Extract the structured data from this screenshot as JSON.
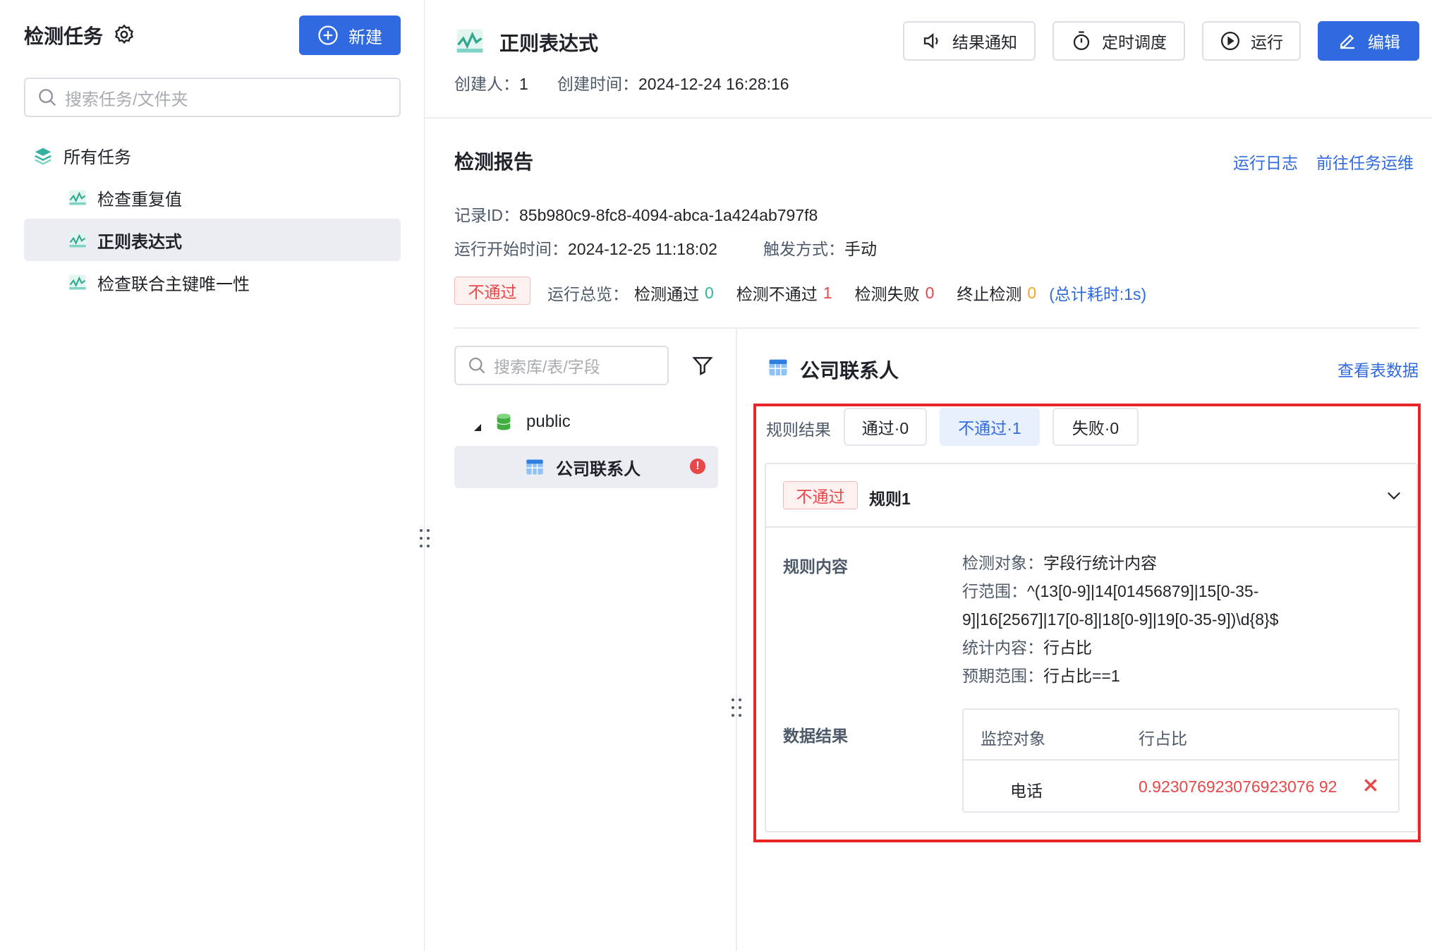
{
  "sidebar": {
    "title": "检测任务",
    "new_button": "新建",
    "search_placeholder": "搜索任务/文件夹",
    "root_label": "所有任务",
    "items": [
      {
        "label": "检查重复值"
      },
      {
        "label": "正则表达式"
      },
      {
        "label": "检查联合主键唯一性"
      }
    ]
  },
  "header": {
    "task_title": "正则表达式",
    "creator_label": "创建人：",
    "creator_value": "1",
    "created_time_label": "创建时间：",
    "created_time_value": "2024-12-24 16:28:16",
    "buttons": {
      "notify": "结果通知",
      "schedule": "定时调度",
      "run": "运行",
      "edit": "编辑"
    }
  },
  "report": {
    "title": "检测报告",
    "run_log_link": "运行日志",
    "ops_link": "前往任务运维",
    "record_id_label": "记录ID：",
    "record_id_value": "85b980c9-8fc8-4094-abca-1a424ab797f8",
    "start_time_label": "运行开始时间：",
    "start_time_value": "2024-12-25 11:18:02",
    "trigger_label": "触发方式：",
    "trigger_value": "手动",
    "status_tag": "不通过",
    "overview_label": "运行总览：",
    "pass_label": "检测通过",
    "pass_count": "0",
    "notpass_label": "检测不通过",
    "notpass_count": "1",
    "fail_label": "检测失败",
    "fail_count": "0",
    "stop_label": "终止检测",
    "stop_count": "0",
    "total_time": "(总计耗时:1s)"
  },
  "tree": {
    "search_placeholder": "搜索库/表/字段",
    "schema": "public",
    "table": "公司联系人"
  },
  "detail": {
    "table_title": "公司联系人",
    "view_data_link": "查看表数据",
    "rule_result_label": "规则结果",
    "tabs": [
      "通过·0",
      "不通过·1",
      "失败·0"
    ],
    "rule_status": "不通过",
    "rule_name": "规则1",
    "content_label": "规则内容",
    "content_lines": [
      {
        "k": "检测对象：",
        "v": "字段行统计内容"
      },
      {
        "k": "行范围：",
        "v": "^(13[0-9]|14[01456879]|15[0-35-"
      },
      {
        "k": "",
        "v": "9]|16[2567]|17[0-8]|18[0-9]|19[0-35-9])\\d{8}$"
      },
      {
        "k": "统计内容：",
        "v": "行占比"
      },
      {
        "k": "预期范围：",
        "v": "行占比==1"
      }
    ],
    "data_result_label": "数据结果",
    "result_headers": [
      "监控对象",
      "行占比"
    ],
    "result_rows": [
      {
        "object": "电话",
        "ratio": "0.923076923076923076 92"
      }
    ]
  },
  "colors": {
    "primary": "#2f6ae1",
    "fail_red": "#e84749",
    "pass_green": "#2fb89a",
    "stop_orange": "#f5a623",
    "highlight_box": "#e8262a"
  }
}
